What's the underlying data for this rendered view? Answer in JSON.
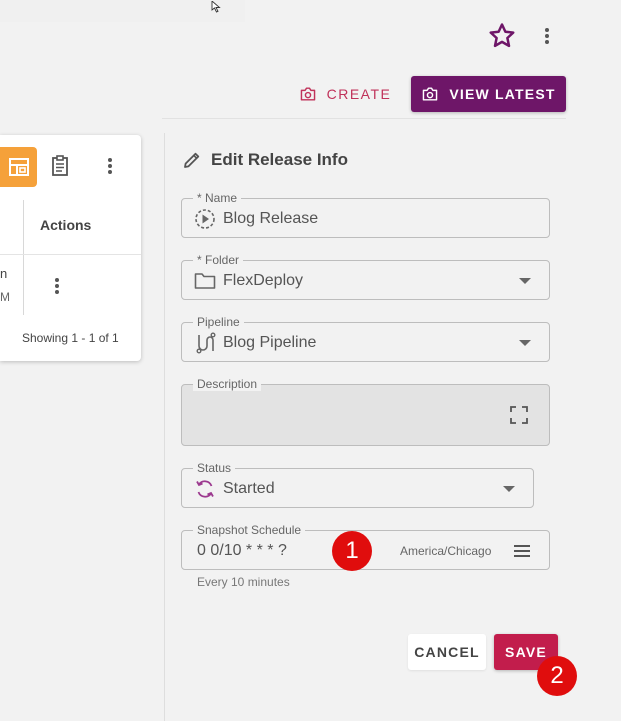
{
  "header": {
    "create_label": "CREATE",
    "view_latest_label": "VIEW LATEST",
    "icons": {
      "star": "star-outline-icon",
      "more": "more-vert-icon",
      "camera": "camera-icon"
    }
  },
  "table_card": {
    "column_header": "Actions",
    "row_truncated_line1": "n",
    "row_truncated_line2": "M",
    "pagination": "Showing 1 - 1 of 1"
  },
  "form": {
    "title": "Edit Release Info",
    "name": {
      "label": "* Name",
      "value": "Blog Release"
    },
    "folder": {
      "label": "* Folder",
      "value": "FlexDeploy"
    },
    "pipeline": {
      "label": "Pipeline",
      "value": "Blog Pipeline"
    },
    "description": {
      "label": "Description",
      "value": ""
    },
    "status": {
      "label": "Status",
      "value": "Started"
    },
    "snapshot_schedule": {
      "label": "Snapshot Schedule",
      "value": "0 0/10 * * * ?",
      "timezone": "America/Chicago",
      "hint": "Every 10 minutes"
    },
    "cancel_label": "CANCEL",
    "save_label": "SAVE"
  },
  "markers": {
    "first": "1",
    "second": "2"
  },
  "colors": {
    "primary": "#6e1668",
    "accent": "#c21d4c",
    "create_text": "#c0325a",
    "orange": "#f5a13a",
    "marker": "#e00d0d",
    "status_icon": "#9c3a8f"
  }
}
